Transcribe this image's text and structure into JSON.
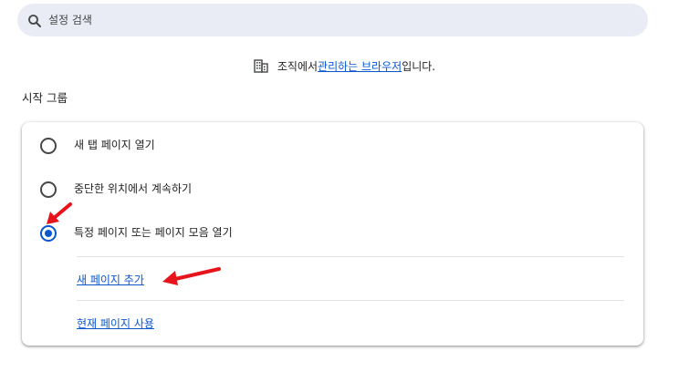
{
  "search": {
    "placeholder": "설정 검색",
    "icon": "search-icon"
  },
  "managed_notice": {
    "icon": "building-icon",
    "prefix": "조직에서 ",
    "link": "관리하는 브라우저",
    "suffix": "입니다."
  },
  "startup": {
    "title": "시작 그룹",
    "options": [
      {
        "label": "새 탭 페이지 열기",
        "checked": false
      },
      {
        "label": "중단한 위치에서 계속하기",
        "checked": false
      },
      {
        "label": "특정 페이지 또는 페이지 모음 열기",
        "checked": true
      }
    ],
    "links": {
      "add_page": "새 페이지 추가",
      "use_current": "현재 페이지 사용"
    }
  },
  "colors": {
    "accent": "#0b57d0",
    "annotation_arrow": "#e8141c",
    "search_bg": "#e9ebf5"
  }
}
